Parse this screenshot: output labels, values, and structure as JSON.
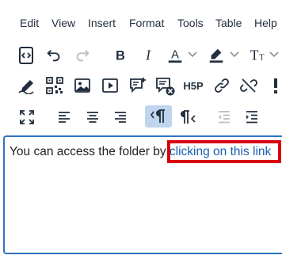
{
  "menubar": {
    "items": [
      "Edit",
      "View",
      "Insert",
      "Format",
      "Tools",
      "Table",
      "Help"
    ]
  },
  "editor": {
    "text_before": "You can access the folder by ",
    "link_text": "clicking on this link"
  },
  "colors": {
    "accent": "#2f74c0",
    "highlight": "#d9000d",
    "active_button": "#bfd5ee"
  }
}
